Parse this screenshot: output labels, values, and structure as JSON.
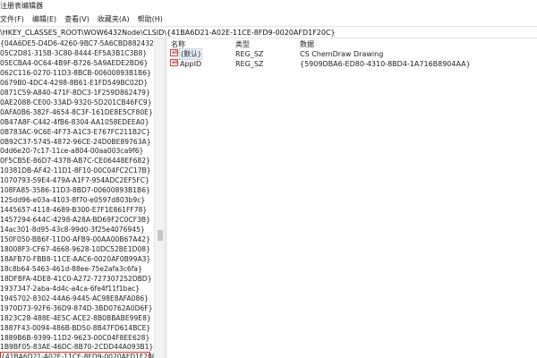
{
  "window": {
    "title": "注册表编辑器"
  },
  "menu": [
    "文件(F)",
    "编辑(E)",
    "查看(V)",
    "收藏夹(A)",
    "帮助(H)"
  ],
  "address": "\\HKEY_CLASSES_ROOT\\WOW6432Node\\CLSID\\{41BA6D21-A02E-11CE-8FD9-0020AFD1F20C}",
  "tree": {
    "items": [
      "{04A6DE5-D4D6-4260-9BC7-5A6CBD882432}",
      "05C2D81-315B-3C80-8444-EF5A3B1C3B8}",
      "05ECBA4-0C64-4B9F-B726-5A9AEDE2BD6}",
      "062C116-0270-11D3-8BCB-00600893B1B6}",
      "0679B0-4DC4-4298-8B61-E1FD549BC02D}",
      "0871C59-A840-471F-8DC3-1F259D862479}",
      "0AE2088-CE00-33AD-9320-5D201CB46FC9}",
      "0AFA0B6-382F-4654-8C3F-161DE8E5CF80E}",
      "0B47A8F-C442-4fB6-8304-AA1058EDEEA0}",
      "0B783AC-9C6E-4F73-A1C3-E767FC211B2C}",
      "0B92C37-5745-4872-96CE-24D0BE89763A}",
      "0dd6e20-7c17-11ce-a804-00aa003ca9f6}",
      "0F5CB5E-86D7-4378-AB7C-CE06448EF682}",
      "10381DB-AF42-11D1-8F10-00C04FC2C17B}",
      "1070793-59E4-479A-A1F7-954ADC2EF5FC}",
      "108FA85-3586-11D3-8BD7-00600893B1B6}",
      "125dd96-e03a-4103-8f70-e0597d803b9c}",
      "1445657-4118-4689-B300-E7F1E861FF78}",
      "1457294-644C-4298-A28A-BD69F2C0CF3B}",
      "14ac301-8d95-43c8-99d0-3f25e4076945}",
      "150F050-BB6F-11D0-AFB9-00AA00B67A42}",
      "18008F3-CF67-4668-9628-10DC52BE1D08}",
      "18AFB70-FBB8-11CE-AAC6-0020AF0B99A3}",
      "18c8b64-5463-461d-88ee-75e2afa3c6fa}",
      "18DFBFA-4DE8-41C0-A272-727307252DBD}",
      "1937347-2aba-4d4c-a4ca-6fe4f11f1bac}",
      "1945702-8302-44A6-9445-AC98E8AFA086}",
      "1970D73-92F6-36D9-874D-3BD0762A0D6F}",
      "1823C28-488E-4E5C-ACE2-8B0BBABE99E8}",
      "1887F43-0094-486B-BD50-8B47FD614BCE}",
      "1889B6B-9399-11D2-9623-00C04F8EE628}",
      "1B9BF05-83AE-46DC-8B70-2CDD44A093B1}",
      "{41BA6D21-A02E-11CE-8FD9-0020AFD1F20C}"
    ],
    "selected_index": 32
  },
  "values": {
    "headers": {
      "name": "名称",
      "type": "类型",
      "data": "数据"
    },
    "rows": [
      {
        "icon": "reg-string-icon",
        "name": "(默认)",
        "type": "REG_SZ",
        "data": "CS ChemDraw Drawing"
      },
      {
        "icon": "reg-string-icon",
        "name": "AppID",
        "type": "REG_SZ",
        "data": "{5909DBA6-ED80-4310-8BD4-1A716B8904AA}"
      }
    ]
  },
  "colors": {
    "selection_outline": "#d9332b",
    "background": "#ffffff",
    "scrollbar": "#f3f3f3"
  }
}
